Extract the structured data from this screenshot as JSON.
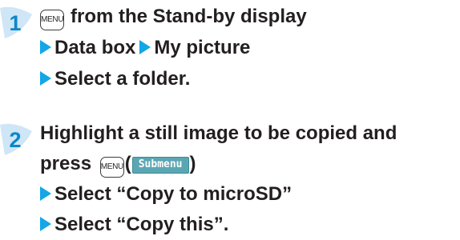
{
  "steps": [
    {
      "number": "1",
      "lines": {
        "first_suffix": "from the Stand-by display",
        "item_a": "Data box",
        "item_b": "My picture",
        "item_c": "Select a folder."
      }
    },
    {
      "number": "2",
      "lines": {
        "first": "Highlight a still image to be copied and",
        "press": "press",
        "paren_open": "(",
        "paren_close": ")",
        "item_a": "Select “Copy to microSD”",
        "item_b": "Select “Copy this”."
      }
    }
  ],
  "keys": {
    "menu_label": "MENU",
    "softkey_label": "Submenu"
  },
  "colors": {
    "step_number": "#0b86c8",
    "arrow": "#14a6e6",
    "softkey_bg": "#5aa7b3",
    "text": "#231f20"
  }
}
